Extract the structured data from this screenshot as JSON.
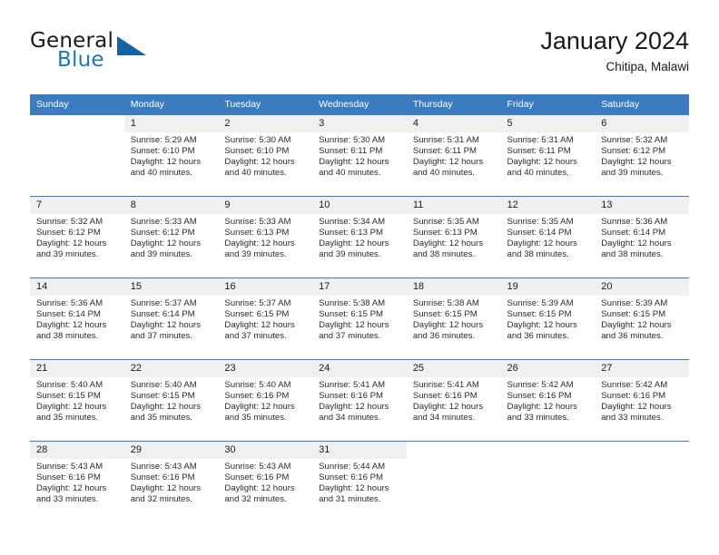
{
  "brand": {
    "name_part1": "General",
    "name_part2": "Blue",
    "logo_icon": "triangle-logo-icon"
  },
  "header": {
    "title": "January 2024",
    "subtitle": "Chitipa, Malawi"
  },
  "colors": {
    "header_blue": "#3b7cc0",
    "brand_blue": "#1878be",
    "daynum_bg": "#ededed",
    "text": "#1a1a1a"
  },
  "weekdays": [
    "Sunday",
    "Monday",
    "Tuesday",
    "Wednesday",
    "Thursday",
    "Friday",
    "Saturday"
  ],
  "weeks": [
    [
      {
        "day": "",
        "sunrise": "",
        "sunset": "",
        "daylight1": "",
        "daylight2": ""
      },
      {
        "day": "1",
        "sunrise": "Sunrise: 5:29 AM",
        "sunset": "Sunset: 6:10 PM",
        "daylight1": "Daylight: 12 hours",
        "daylight2": "and 40 minutes."
      },
      {
        "day": "2",
        "sunrise": "Sunrise: 5:30 AM",
        "sunset": "Sunset: 6:10 PM",
        "daylight1": "Daylight: 12 hours",
        "daylight2": "and 40 minutes."
      },
      {
        "day": "3",
        "sunrise": "Sunrise: 5:30 AM",
        "sunset": "Sunset: 6:11 PM",
        "daylight1": "Daylight: 12 hours",
        "daylight2": "and 40 minutes."
      },
      {
        "day": "4",
        "sunrise": "Sunrise: 5:31 AM",
        "sunset": "Sunset: 6:11 PM",
        "daylight1": "Daylight: 12 hours",
        "daylight2": "and 40 minutes."
      },
      {
        "day": "5",
        "sunrise": "Sunrise: 5:31 AM",
        "sunset": "Sunset: 6:11 PM",
        "daylight1": "Daylight: 12 hours",
        "daylight2": "and 40 minutes."
      },
      {
        "day": "6",
        "sunrise": "Sunrise: 5:32 AM",
        "sunset": "Sunset: 6:12 PM",
        "daylight1": "Daylight: 12 hours",
        "daylight2": "and 39 minutes."
      }
    ],
    [
      {
        "day": "7",
        "sunrise": "Sunrise: 5:32 AM",
        "sunset": "Sunset: 6:12 PM",
        "daylight1": "Daylight: 12 hours",
        "daylight2": "and 39 minutes."
      },
      {
        "day": "8",
        "sunrise": "Sunrise: 5:33 AM",
        "sunset": "Sunset: 6:12 PM",
        "daylight1": "Daylight: 12 hours",
        "daylight2": "and 39 minutes."
      },
      {
        "day": "9",
        "sunrise": "Sunrise: 5:33 AM",
        "sunset": "Sunset: 6:13 PM",
        "daylight1": "Daylight: 12 hours",
        "daylight2": "and 39 minutes."
      },
      {
        "day": "10",
        "sunrise": "Sunrise: 5:34 AM",
        "sunset": "Sunset: 6:13 PM",
        "daylight1": "Daylight: 12 hours",
        "daylight2": "and 39 minutes."
      },
      {
        "day": "11",
        "sunrise": "Sunrise: 5:35 AM",
        "sunset": "Sunset: 6:13 PM",
        "daylight1": "Daylight: 12 hours",
        "daylight2": "and 38 minutes."
      },
      {
        "day": "12",
        "sunrise": "Sunrise: 5:35 AM",
        "sunset": "Sunset: 6:14 PM",
        "daylight1": "Daylight: 12 hours",
        "daylight2": "and 38 minutes."
      },
      {
        "day": "13",
        "sunrise": "Sunrise: 5:36 AM",
        "sunset": "Sunset: 6:14 PM",
        "daylight1": "Daylight: 12 hours",
        "daylight2": "and 38 minutes."
      }
    ],
    [
      {
        "day": "14",
        "sunrise": "Sunrise: 5:36 AM",
        "sunset": "Sunset: 6:14 PM",
        "daylight1": "Daylight: 12 hours",
        "daylight2": "and 38 minutes."
      },
      {
        "day": "15",
        "sunrise": "Sunrise: 5:37 AM",
        "sunset": "Sunset: 6:14 PM",
        "daylight1": "Daylight: 12 hours",
        "daylight2": "and 37 minutes."
      },
      {
        "day": "16",
        "sunrise": "Sunrise: 5:37 AM",
        "sunset": "Sunset: 6:15 PM",
        "daylight1": "Daylight: 12 hours",
        "daylight2": "and 37 minutes."
      },
      {
        "day": "17",
        "sunrise": "Sunrise: 5:38 AM",
        "sunset": "Sunset: 6:15 PM",
        "daylight1": "Daylight: 12 hours",
        "daylight2": "and 37 minutes."
      },
      {
        "day": "18",
        "sunrise": "Sunrise: 5:38 AM",
        "sunset": "Sunset: 6:15 PM",
        "daylight1": "Daylight: 12 hours",
        "daylight2": "and 36 minutes."
      },
      {
        "day": "19",
        "sunrise": "Sunrise: 5:39 AM",
        "sunset": "Sunset: 6:15 PM",
        "daylight1": "Daylight: 12 hours",
        "daylight2": "and 36 minutes."
      },
      {
        "day": "20",
        "sunrise": "Sunrise: 5:39 AM",
        "sunset": "Sunset: 6:15 PM",
        "daylight1": "Daylight: 12 hours",
        "daylight2": "and 36 minutes."
      }
    ],
    [
      {
        "day": "21",
        "sunrise": "Sunrise: 5:40 AM",
        "sunset": "Sunset: 6:15 PM",
        "daylight1": "Daylight: 12 hours",
        "daylight2": "and 35 minutes."
      },
      {
        "day": "22",
        "sunrise": "Sunrise: 5:40 AM",
        "sunset": "Sunset: 6:15 PM",
        "daylight1": "Daylight: 12 hours",
        "daylight2": "and 35 minutes."
      },
      {
        "day": "23",
        "sunrise": "Sunrise: 5:40 AM",
        "sunset": "Sunset: 6:16 PM",
        "daylight1": "Daylight: 12 hours",
        "daylight2": "and 35 minutes."
      },
      {
        "day": "24",
        "sunrise": "Sunrise: 5:41 AM",
        "sunset": "Sunset: 6:16 PM",
        "daylight1": "Daylight: 12 hours",
        "daylight2": "and 34 minutes."
      },
      {
        "day": "25",
        "sunrise": "Sunrise: 5:41 AM",
        "sunset": "Sunset: 6:16 PM",
        "daylight1": "Daylight: 12 hours",
        "daylight2": "and 34 minutes."
      },
      {
        "day": "26",
        "sunrise": "Sunrise: 5:42 AM",
        "sunset": "Sunset: 6:16 PM",
        "daylight1": "Daylight: 12 hours",
        "daylight2": "and 33 minutes."
      },
      {
        "day": "27",
        "sunrise": "Sunrise: 5:42 AM",
        "sunset": "Sunset: 6:16 PM",
        "daylight1": "Daylight: 12 hours",
        "daylight2": "and 33 minutes."
      }
    ],
    [
      {
        "day": "28",
        "sunrise": "Sunrise: 5:43 AM",
        "sunset": "Sunset: 6:16 PM",
        "daylight1": "Daylight: 12 hours",
        "daylight2": "and 33 minutes."
      },
      {
        "day": "29",
        "sunrise": "Sunrise: 5:43 AM",
        "sunset": "Sunset: 6:16 PM",
        "daylight1": "Daylight: 12 hours",
        "daylight2": "and 32 minutes."
      },
      {
        "day": "30",
        "sunrise": "Sunrise: 5:43 AM",
        "sunset": "Sunset: 6:16 PM",
        "daylight1": "Daylight: 12 hours",
        "daylight2": "and 32 minutes."
      },
      {
        "day": "31",
        "sunrise": "Sunrise: 5:44 AM",
        "sunset": "Sunset: 6:16 PM",
        "daylight1": "Daylight: 12 hours",
        "daylight2": "and 31 minutes."
      },
      {
        "day": "",
        "sunrise": "",
        "sunset": "",
        "daylight1": "",
        "daylight2": ""
      },
      {
        "day": "",
        "sunrise": "",
        "sunset": "",
        "daylight1": "",
        "daylight2": ""
      },
      {
        "day": "",
        "sunrise": "",
        "sunset": "",
        "daylight1": "",
        "daylight2": ""
      }
    ]
  ]
}
